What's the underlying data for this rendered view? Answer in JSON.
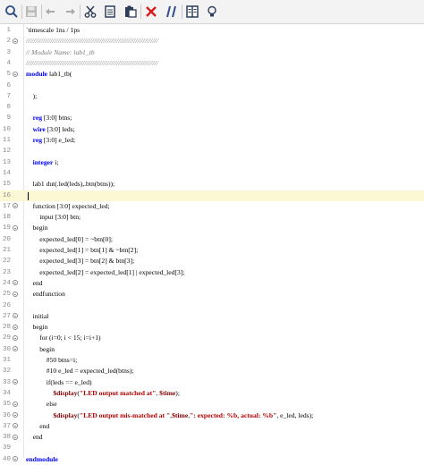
{
  "toolbar": {
    "icons": [
      "search-icon",
      "save-icon",
      "undo-icon",
      "redo-icon",
      "cut-icon",
      "copy-icon",
      "paste-icon",
      "delete-icon",
      "comment-icon",
      "columns-icon",
      "lightbulb-icon"
    ]
  },
  "editor": {
    "lines": [
      {
        "n": "1",
        "segs": [
          {
            "t": "`timescale 1ns / 1ps",
            "c": ""
          }
        ]
      },
      {
        "n": "2",
        "fold": true,
        "segs": [
          {
            "t": "//////////////////////////////////////////////////////////////////////",
            "c": "cm"
          }
        ]
      },
      {
        "n": "3",
        "segs": [
          {
            "t": "// Module Name: lab1_tb",
            "c": "cm"
          }
        ]
      },
      {
        "n": "4",
        "segs": [
          {
            "t": "//////////////////////////////////////////////////////////////////////",
            "c": "cm"
          }
        ]
      },
      {
        "n": "5",
        "fold": true,
        "segs": [
          {
            "t": "module",
            "c": "kw"
          },
          {
            "t": " lab1_tb(",
            "c": ""
          }
        ]
      },
      {
        "n": "6",
        "segs": []
      },
      {
        "n": "7",
        "segs": [
          {
            "t": "    );",
            "c": ""
          }
        ]
      },
      {
        "n": "8",
        "segs": []
      },
      {
        "n": "9",
        "segs": [
          {
            "t": "    ",
            "c": ""
          },
          {
            "t": "reg",
            "c": "kw"
          },
          {
            "t": " [3:0] btns;",
            "c": ""
          }
        ]
      },
      {
        "n": "10",
        "segs": [
          {
            "t": "    ",
            "c": ""
          },
          {
            "t": "wire",
            "c": "kw"
          },
          {
            "t": " [3:0] leds;",
            "c": ""
          }
        ]
      },
      {
        "n": "11",
        "segs": [
          {
            "t": "    ",
            "c": ""
          },
          {
            "t": "reg",
            "c": "kw"
          },
          {
            "t": " [3:0] e_led;",
            "c": ""
          }
        ]
      },
      {
        "n": "12",
        "segs": []
      },
      {
        "n": "13",
        "segs": [
          {
            "t": "    ",
            "c": ""
          },
          {
            "t": "integer",
            "c": "kw"
          },
          {
            "t": " i;",
            "c": ""
          }
        ]
      },
      {
        "n": "14",
        "segs": []
      },
      {
        "n": "15",
        "segs": [
          {
            "t": "    lab1 dut(.led(leds),.btn(btns));",
            "c": ""
          }
        ]
      },
      {
        "n": "16",
        "current": true,
        "segs": []
      },
      {
        "n": "17",
        "fold": true,
        "segs": [
          {
            "t": "    function [3:0] expected_led;",
            "c": ""
          }
        ]
      },
      {
        "n": "18",
        "segs": [
          {
            "t": "        input [3:0] btn;",
            "c": ""
          }
        ]
      },
      {
        "n": "19",
        "fold": true,
        "segs": [
          {
            "t": "    begin",
            "c": ""
          }
        ]
      },
      {
        "n": "20",
        "segs": [
          {
            "t": "        expected_led[0] = ~btn[0];",
            "c": ""
          }
        ]
      },
      {
        "n": "21",
        "segs": [
          {
            "t": "        expected_led[1] = btn[1] & ~btn[2];",
            "c": ""
          }
        ]
      },
      {
        "n": "22",
        "segs": [
          {
            "t": "        expected_led[3] = btn[2] & btn[3];",
            "c": ""
          }
        ]
      },
      {
        "n": "23",
        "segs": [
          {
            "t": "        expected_led[2] = expected_led[1] | expected_led[3];",
            "c": ""
          }
        ]
      },
      {
        "n": "24",
        "fold": true,
        "segs": [
          {
            "t": "    end",
            "c": ""
          }
        ]
      },
      {
        "n": "25",
        "fold": true,
        "segs": [
          {
            "t": "    endfunction",
            "c": ""
          }
        ]
      },
      {
        "n": "26",
        "segs": []
      },
      {
        "n": "27",
        "fold": true,
        "segs": [
          {
            "t": "    initial",
            "c": ""
          }
        ]
      },
      {
        "n": "28",
        "fold": true,
        "segs": [
          {
            "t": "    begin",
            "c": ""
          }
        ]
      },
      {
        "n": "29",
        "fold": true,
        "segs": [
          {
            "t": "        for (i=0; i < 15; i=i+1)",
            "c": ""
          }
        ]
      },
      {
        "n": "30",
        "fold": true,
        "segs": [
          {
            "t": "        begin",
            "c": ""
          }
        ]
      },
      {
        "n": "31",
        "segs": [
          {
            "t": "            #50 btns=i;",
            "c": ""
          }
        ]
      },
      {
        "n": "32",
        "segs": [
          {
            "t": "            #10 e_led = expected_led(btns);",
            "c": ""
          }
        ]
      },
      {
        "n": "33",
        "fold": true,
        "segs": [
          {
            "t": "            if(leds == e_led)",
            "c": ""
          }
        ]
      },
      {
        "n": "34",
        "segs": [
          {
            "t": "                ",
            "c": ""
          },
          {
            "t": "$display",
            "c": "sys"
          },
          {
            "t": "(",
            "c": ""
          },
          {
            "t": "\"LED output matched at\"",
            "c": "st"
          },
          {
            "t": ", ",
            "c": ""
          },
          {
            "t": "$time",
            "c": "sys"
          },
          {
            "t": ");",
            "c": ""
          }
        ]
      },
      {
        "n": "35",
        "fold": true,
        "segs": [
          {
            "t": "            else",
            "c": ""
          }
        ]
      },
      {
        "n": "36",
        "fold": true,
        "segs": [
          {
            "t": "                ",
            "c": ""
          },
          {
            "t": "$display",
            "c": "sys"
          },
          {
            "t": "(",
            "c": ""
          },
          {
            "t": "\"LED output mis-matched at \"",
            "c": "st"
          },
          {
            "t": ",",
            "c": ""
          },
          {
            "t": "$time",
            "c": "sys"
          },
          {
            "t": ",",
            "c": ""
          },
          {
            "t": "\": expected: %b, actual: %b\"",
            "c": "st"
          },
          {
            "t": ", e_led, leds);",
            "c": ""
          }
        ]
      },
      {
        "n": "37",
        "fold": true,
        "segs": [
          {
            "t": "        end",
            "c": ""
          }
        ]
      },
      {
        "n": "38",
        "fold": true,
        "segs": [
          {
            "t": "    end",
            "c": ""
          }
        ]
      },
      {
        "n": "39",
        "segs": []
      },
      {
        "n": "40",
        "fold": true,
        "segs": [
          {
            "t": "endmodule",
            "c": "kw"
          }
        ]
      }
    ]
  }
}
